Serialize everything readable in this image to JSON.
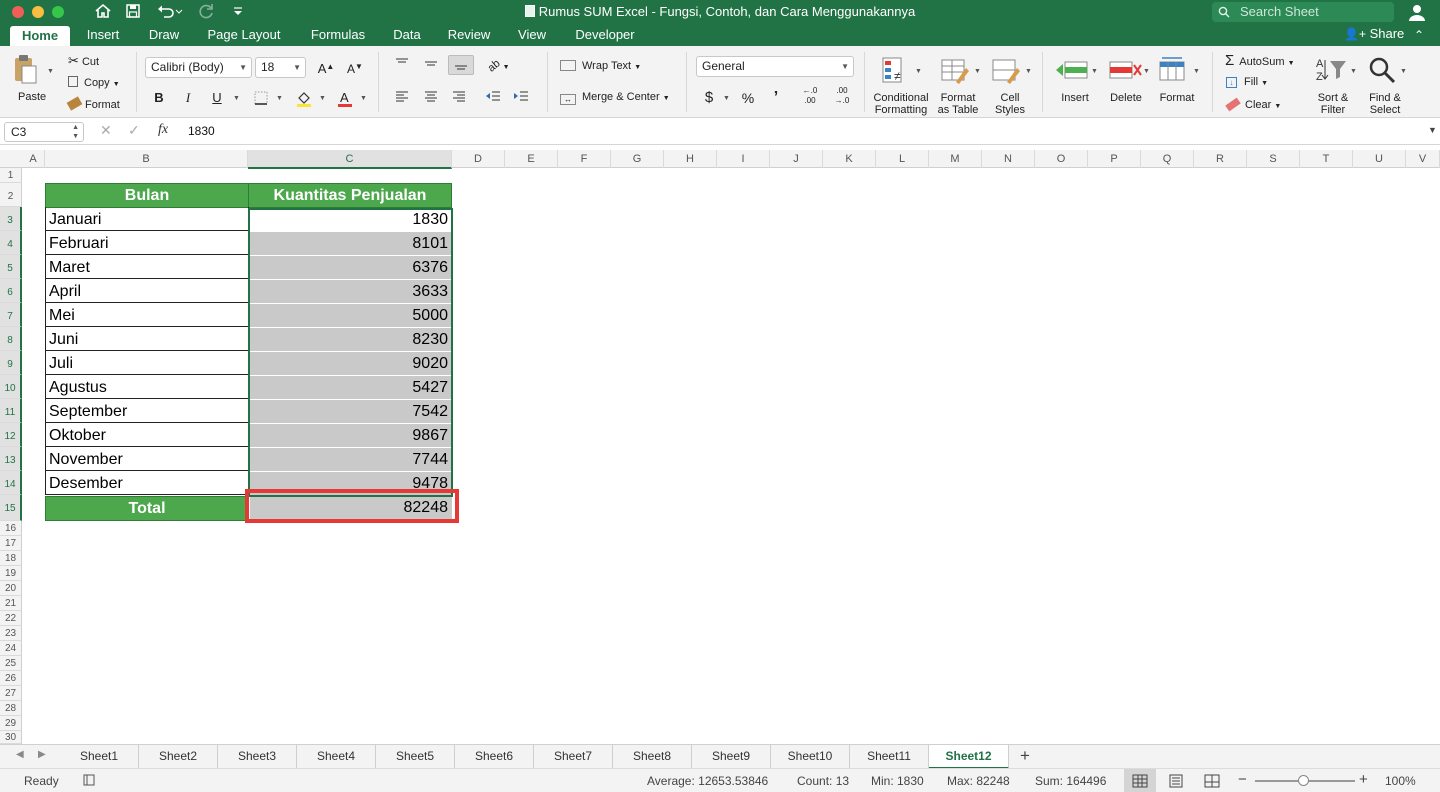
{
  "window": {
    "title": "Rumus SUM Excel - Fungsi, Contoh, dan Cara Menggunakannya",
    "search_placeholder": "Search Sheet",
    "accent": "#217346"
  },
  "tabs": [
    "Home",
    "Insert",
    "Draw",
    "Page Layout",
    "Formulas",
    "Data",
    "Review",
    "View",
    "Developer"
  ],
  "share_label": "Share",
  "ribbon": {
    "paste": "Paste",
    "cut": "Cut",
    "copy": "Copy",
    "format": "Format",
    "font_name": "Calibri (Body)",
    "font_size": "18",
    "bold": "B",
    "italic": "I",
    "underline": "U",
    "wrap_text": "Wrap Text",
    "merge_center": "Merge & Center",
    "number_format": "General",
    "currency": "$",
    "percent": "%",
    "comma": "’",
    "conditional_formatting": [
      "Conditional",
      "Formatting"
    ],
    "format_as_table": [
      "Format",
      "as Table"
    ],
    "cell_styles": [
      "Cell",
      "Styles"
    ],
    "insert": "Insert",
    "delete": "Delete",
    "format_cells": "Format",
    "autosum": "AutoSum",
    "fill": "Fill",
    "clear": "Clear",
    "sort_filter": [
      "Sort &",
      "Filter"
    ],
    "find_select": [
      "Find &",
      "Select"
    ]
  },
  "formula_bar": {
    "name_box": "C3",
    "fx": "fx",
    "value": "1830"
  },
  "columns": [
    "A",
    "B",
    "C",
    "D",
    "E",
    "F",
    "G",
    "H",
    "I",
    "J",
    "K",
    "L",
    "M",
    "N",
    "O",
    "P",
    "Q",
    "R",
    "S",
    "T",
    "U",
    "V"
  ],
  "rows": [
    "1",
    "2",
    "3",
    "4",
    "5",
    "6",
    "7",
    "8",
    "9",
    "10",
    "11",
    "12",
    "13",
    "14",
    "15",
    "16",
    "17",
    "18",
    "19",
    "20",
    "21",
    "22",
    "23",
    "24",
    "25",
    "26",
    "27",
    "28",
    "29",
    "30"
  ],
  "table": {
    "header_month": "Bulan",
    "header_qty": "Kuantitas Penjualan",
    "months": [
      "Januari",
      "Februari",
      "Maret",
      "April",
      "Mei",
      "Juni",
      "Juli",
      "Agustus",
      "September",
      "Oktober",
      "November",
      "Desember"
    ],
    "quantities": [
      "1830",
      "8101",
      "6376",
      "3633",
      "5000",
      "8230",
      "9020",
      "5427",
      "7542",
      "9867",
      "7744",
      "9478"
    ],
    "total_label": "Total",
    "total_value": "82248"
  },
  "sheets": [
    "Sheet1",
    "Sheet2",
    "Sheet3",
    "Sheet4",
    "Sheet5",
    "Sheet6",
    "Sheet7",
    "Sheet8",
    "Sheet9",
    "Sheet10",
    "Sheet11",
    "Sheet12"
  ],
  "active_sheet": "Sheet12",
  "status": {
    "mode": "Ready",
    "average": "Average: 12653.53846",
    "count": "Count: 13",
    "min": "Min: 1830",
    "max": "Max: 82248",
    "sum": "Sum: 164496",
    "zoom": "100%"
  }
}
